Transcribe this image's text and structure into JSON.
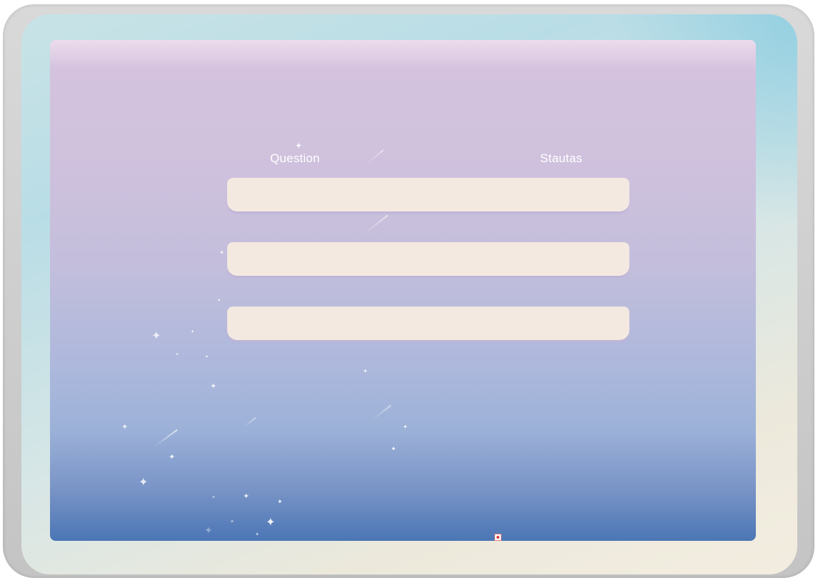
{
  "table": {
    "headers": {
      "question": "Question",
      "status": "Stautas"
    },
    "rows": [
      {
        "question": "",
        "status": ""
      },
      {
        "question": "",
        "status": ""
      },
      {
        "question": "",
        "status": ""
      }
    ]
  },
  "icons": {
    "sparkle": "sparkle-icon",
    "corner": "warning-icon"
  },
  "colors": {
    "screen_top": "#ecdcec",
    "screen_bottom": "#4b76b5",
    "row_fill": "#f4e9e0",
    "header_text": "#ffffff"
  }
}
